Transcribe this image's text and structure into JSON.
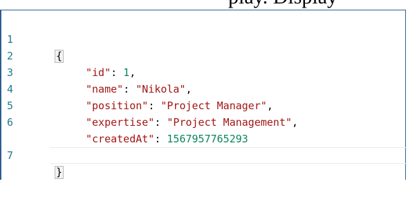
{
  "top_strip_text": "play. Display",
  "code": {
    "line_numbers": [
      "1",
      "2",
      "3",
      "4",
      "5",
      "6",
      "7"
    ],
    "open_brace": "{",
    "close_brace": "}",
    "entries": [
      {
        "key": "\"id\"",
        "value": "1",
        "value_type": "number",
        "trailing": ","
      },
      {
        "key": "\"name\"",
        "value": "\"Nikola\"",
        "value_type": "string",
        "trailing": ","
      },
      {
        "key": "\"position\"",
        "value": "\"Project Manager\"",
        "value_type": "string",
        "trailing": ","
      },
      {
        "key": "\"expertise\"",
        "value": "\"Project Management\"",
        "value_type": "string",
        "trailing": ","
      },
      {
        "key": "\"createdAt\"",
        "value": "1567957765293",
        "value_type": "number",
        "trailing": ""
      }
    ]
  },
  "colors": {
    "line_number": "#237893",
    "json_key": "#a31515",
    "json_string": "#a31515",
    "json_number": "#098658",
    "frame_border": "#2e5d92"
  }
}
